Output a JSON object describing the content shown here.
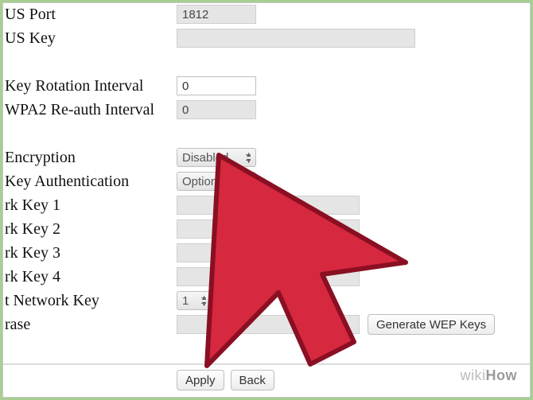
{
  "fields": {
    "us_port": {
      "label": "US Port",
      "value": "1812"
    },
    "us_key": {
      "label": "US Key",
      "value": ""
    },
    "key_rotation": {
      "label": "Key Rotation Interval",
      "value": "0"
    },
    "wpa2_reauth": {
      "label": "WPA2 Re-auth Interval",
      "value": "0"
    },
    "encryption": {
      "label": "Encryption",
      "value": "Disabled"
    },
    "key_auth": {
      "label": " Key Authentication",
      "value": "Optional"
    },
    "rk_key1": {
      "label": "rk Key 1",
      "value": ""
    },
    "rk_key2": {
      "label": "rk Key 2",
      "value": ""
    },
    "rk_key3": {
      "label": "rk Key 3",
      "value": ""
    },
    "rk_key4": {
      "label": "rk Key 4",
      "value": ""
    },
    "network_key": {
      "label": "t Network Key",
      "value": "1"
    },
    "rase": {
      "label": "rase",
      "value": ""
    }
  },
  "buttons": {
    "generate": "Generate WEP Keys",
    "apply": "Apply",
    "back": "Back"
  },
  "watermark": {
    "pre": "wiki",
    "post": "How"
  }
}
